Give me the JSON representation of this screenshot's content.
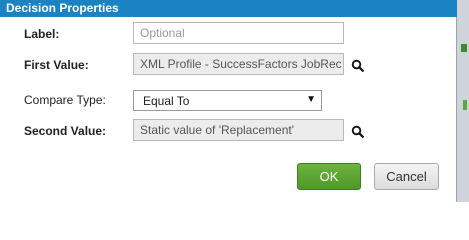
{
  "dialog": {
    "title": "Decision Properties"
  },
  "fields": {
    "label": {
      "label": "Label:",
      "placeholder": "Optional"
    },
    "first_value": {
      "label": "First Value:",
      "value": "XML Profile - SuccessFactors JobRec"
    },
    "compare_type": {
      "label": "Compare Type:",
      "selected": "Equal To"
    },
    "second_value": {
      "label": "Second Value:",
      "value": "Static value of 'Replacement'"
    }
  },
  "buttons": {
    "ok": "OK",
    "cancel": "Cancel"
  },
  "icons": {
    "browse": "magnifier-icon",
    "dropdown": "chevron-down-icon"
  },
  "colors": {
    "titlebar": "#1b82c4",
    "ok_button": "#5aa632"
  }
}
